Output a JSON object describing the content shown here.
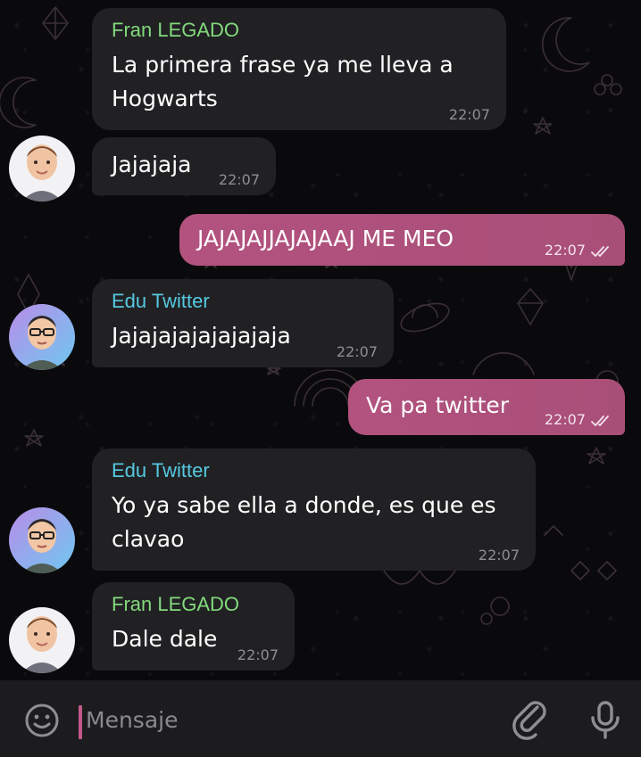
{
  "colors": {
    "fran_name": "#83d97c",
    "edu_name": "#55c9df",
    "incoming_bubble": "#212124",
    "outgoing_bubble": "#b3527f",
    "timestamp": "#8e8e93",
    "input_bar": "#1c1c1e"
  },
  "messages": [
    {
      "sender": "Fran LEGADO",
      "lines": [
        "La primera frase ya me lleva a",
        "Hogwarts"
      ],
      "time": "22:07"
    },
    {
      "lines": [
        "Jajajaja"
      ],
      "time": "22:07",
      "avatar": "Fran LEGADO"
    },
    {
      "lines": [
        "JAJAJAJJAJAJAAJ ME MEO"
      ],
      "time": "22:07",
      "outgoing": true,
      "status": "read-double-check-icon"
    },
    {
      "sender": "Edu Twitter",
      "lines": [
        "Jajajajajajajajaja"
      ],
      "time": "22:07",
      "avatar": "Edu Twitter"
    },
    {
      "lines": [
        "Va pa twitter"
      ],
      "time": "22:07",
      "outgoing": true,
      "status": "read-double-check-icon"
    },
    {
      "sender": "Edu Twitter",
      "lines": [
        "Yo ya sabe ella a donde, es que es",
        "clavao"
      ],
      "time": "22:07",
      "avatar": "Edu Twitter"
    },
    {
      "sender": "Fran LEGADO",
      "lines": [
        "Dale dale"
      ],
      "time": "22:07",
      "avatar": "Fran LEGADO"
    }
  ],
  "input": {
    "placeholder": "Mensaje",
    "value": "",
    "emoji_icon": "smiley-icon",
    "attach_icon": "paperclip-icon",
    "mic_icon": "microphone-icon"
  }
}
